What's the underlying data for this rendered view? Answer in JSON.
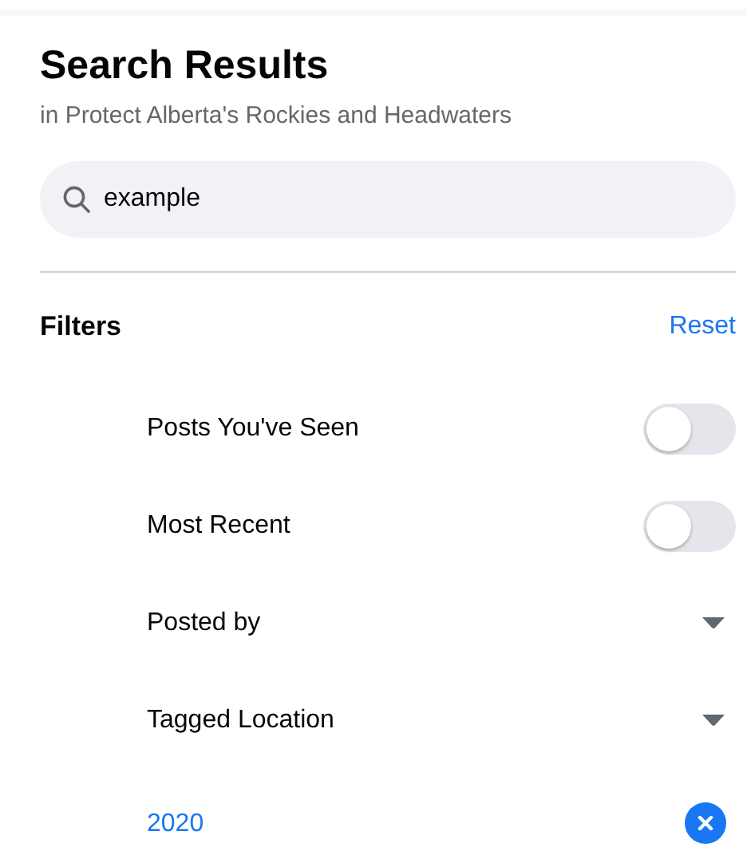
{
  "header": {
    "title": "Search Results",
    "subtitle": "in Protect Alberta's Rockies and Headwaters"
  },
  "search": {
    "value": "example"
  },
  "filters": {
    "title": "Filters",
    "reset": "Reset",
    "items": [
      {
        "kind": "toggle",
        "label": "Posts You've Seen",
        "on": false
      },
      {
        "kind": "toggle",
        "label": "Most Recent",
        "on": false
      },
      {
        "kind": "dropdown",
        "label": "Posted by"
      },
      {
        "kind": "dropdown",
        "label": "Tagged Location"
      },
      {
        "kind": "clearable",
        "label": "2020"
      }
    ]
  }
}
